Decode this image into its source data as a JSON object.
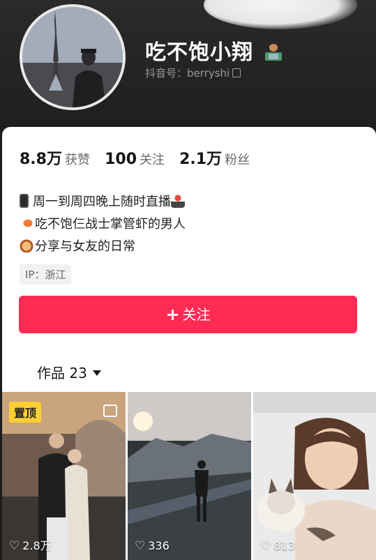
{
  "profile": {
    "nickname": "吃不饱小翔",
    "nickname_emoji": "man-technologist-emoji",
    "douyin_id": "抖音号：berryshi"
  },
  "stats": [
    {
      "value": "8.8万",
      "label": "获赞"
    },
    {
      "value": "100",
      "label": "关注"
    },
    {
      "value": "2.1万",
      "label": "粉丝"
    }
  ],
  "bio": [
    {
      "icon": "mobile-phone-emoji",
      "text": "周一到周四晚上随时直播",
      "trail_icon": "joystick-emoji"
    },
    {
      "icon": "shrimp-emoji",
      "text": "吃不饱仨战士掌管虾的男人"
    },
    {
      "icon": "woman-emoji",
      "text": "分享与女友的日常"
    }
  ],
  "ip_location": "IP：浙江",
  "follow_button": {
    "icon": "plus-icon",
    "label": "关注"
  },
  "works_tab": {
    "label": "作品 23"
  },
  "videos": [
    {
      "pinned_label": "置顶",
      "likes": "2.8万",
      "multi_image": true
    },
    {
      "likes": "336"
    },
    {
      "likes": "813"
    }
  ],
  "colors": {
    "accent": "#fe2c55",
    "pin": "#ffcf33",
    "header_bg": "#1e1e1e"
  }
}
